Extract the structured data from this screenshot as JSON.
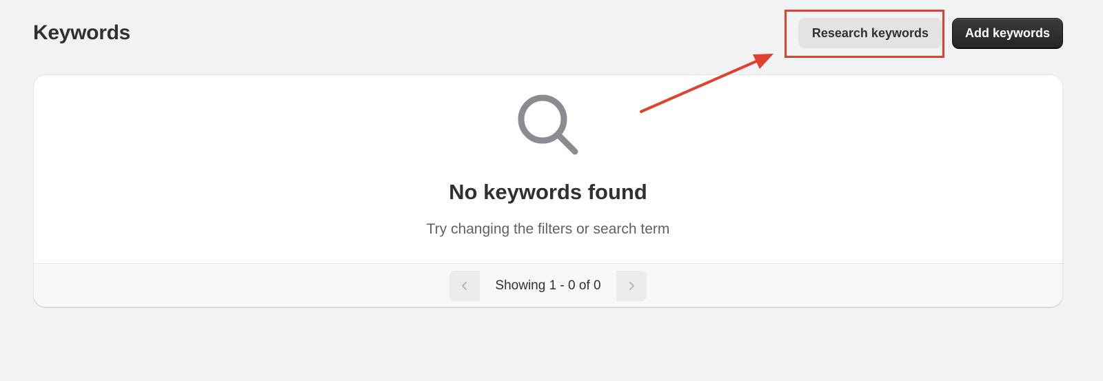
{
  "header": {
    "title": "Keywords",
    "research_label": "Research keywords",
    "add_label": "Add keywords"
  },
  "empty_state": {
    "icon": "search-icon",
    "title": "No keywords found",
    "subtitle": "Try changing the filters or search term"
  },
  "pagination": {
    "label": "Showing 1 - 0 of 0",
    "prev_icon": "chevron-left-icon",
    "next_icon": "chevron-right-icon"
  },
  "annotation": {
    "color": "#e0412f"
  },
  "colors": {
    "background": "#f1f2f4",
    "primary_button": "#303030",
    "secondary_button": "#e3e3e3"
  }
}
